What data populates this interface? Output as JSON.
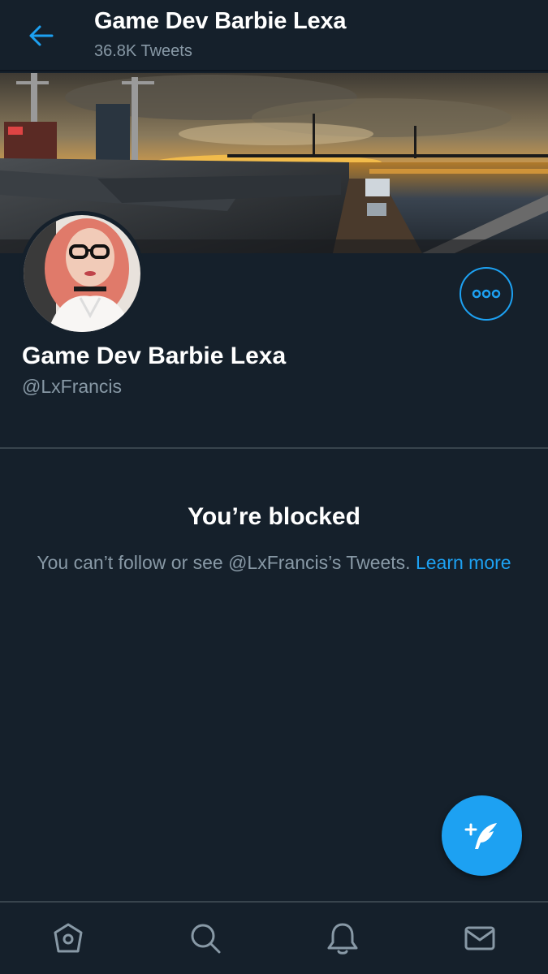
{
  "header": {
    "title": "Game Dev Barbie Lexa",
    "tweet_count": "36.8K Tweets"
  },
  "profile": {
    "name": "Game Dev Barbie Lexa",
    "handle": "@LxFrancis"
  },
  "blocked": {
    "title": "You’re blocked",
    "message": "You can’t follow or see @LxFrancis’s Tweets.",
    "learn_more": "Learn more"
  },
  "icons": {
    "back": "back-arrow-icon",
    "more": "more-options-icon",
    "compose": "compose-tweet-icon",
    "nav": [
      "home-icon",
      "search-icon",
      "notifications-icon",
      "messages-icon"
    ]
  },
  "colors": {
    "background": "#15202b",
    "accent": "#1da1f2",
    "secondary_text": "#8899a6",
    "divider": "#38444d"
  }
}
